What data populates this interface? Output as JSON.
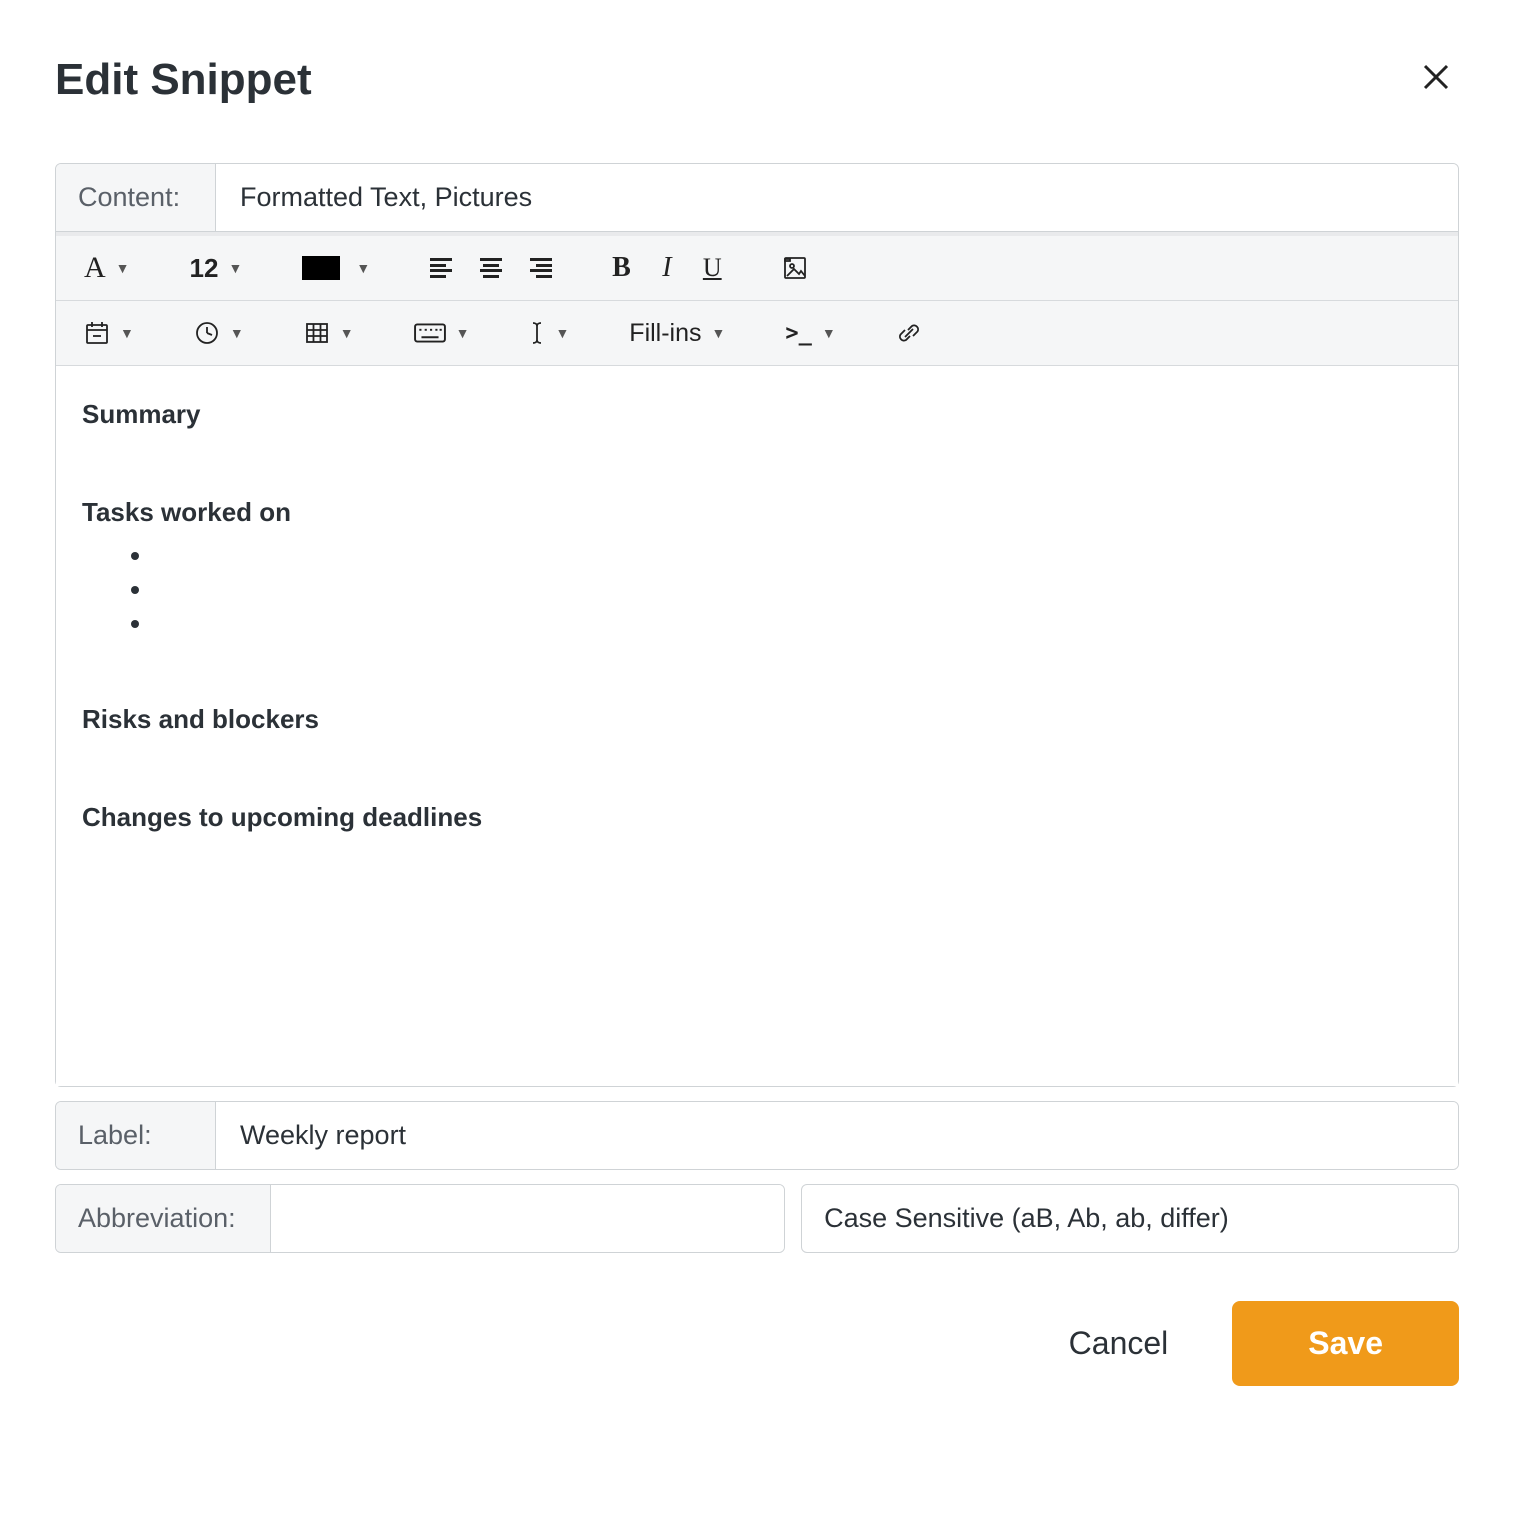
{
  "dialog": {
    "title": "Edit Snippet"
  },
  "content_field": {
    "label": "Content:",
    "value": "Formatted Text, Pictures"
  },
  "toolbar1": {
    "font_size_value": "12",
    "fillins_label": "Fill-ins"
  },
  "editor": {
    "h1": "Summary",
    "h2": "Tasks worked on",
    "h3": "Risks and blockers",
    "h4": "Changes to upcoming deadlines"
  },
  "label_field": {
    "label": "Label:",
    "value": "Weekly report"
  },
  "abbrev_field": {
    "label": "Abbreviation:",
    "value": ""
  },
  "case_field": {
    "value": "Case Sensitive (aB, Ab, ab, differ)"
  },
  "footer": {
    "cancel": "Cancel",
    "save": "Save"
  }
}
